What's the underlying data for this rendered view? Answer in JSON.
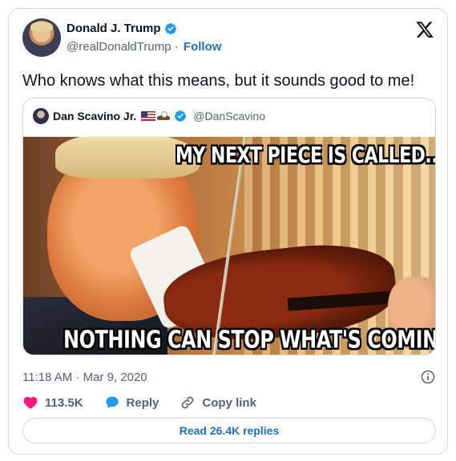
{
  "author": {
    "display_name": "Donald J. Trump",
    "handle": "@realDonaldTrump",
    "separator": "·",
    "follow_label": "Follow"
  },
  "tweet": {
    "text": "Who knows what this means, but it sounds good to me!",
    "timestamp": "11:18 AM · Mar 9, 2020"
  },
  "quoted": {
    "display_name": "Dan Scavino Jr.",
    "handle": "@DanScavino",
    "meme_caption_top": "MY NEXT PIECE IS CALLED...",
    "meme_caption_bottom": "NOTHING CAN STOP WHAT'S COMING."
  },
  "actions": {
    "like_count": "113.5K",
    "reply_label": "Reply",
    "copy_link_label": "Copy link",
    "read_replies_label": "Read 26.4K replies"
  },
  "icons": {
    "verified": "verified-badge-icon",
    "x_logo": "x-logo-icon",
    "info": "info-icon",
    "like": "heart-icon",
    "reply": "speech-bubble-icon",
    "copy_link": "link-icon"
  },
  "colors": {
    "accent": "#1d9bf0",
    "link": "#1d6fc9",
    "like": "#f91880",
    "text": "#0f1419",
    "muted": "#536471",
    "border": "#cfd9de"
  }
}
